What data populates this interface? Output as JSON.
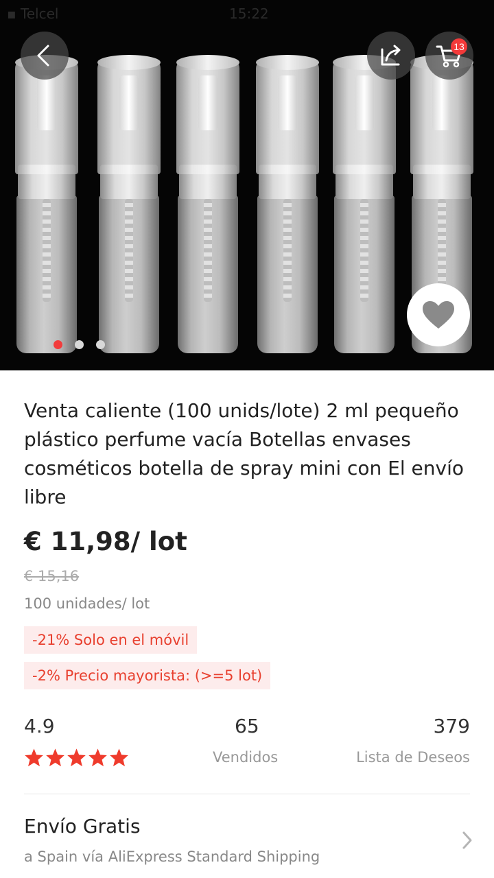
{
  "status_bar": {
    "left": "▪ Telcel ",
    "time": "15:22",
    "right": ""
  },
  "cart": {
    "badge_count": "13"
  },
  "carousel": {
    "total": 3,
    "active_index": 0
  },
  "product": {
    "title": "Venta caliente (100 unids/lote) 2 ml pequeño plástico perfume vacía Botellas envases cosméticos botella de spray mini con El envío libre",
    "price": "€ 11,98/ lot",
    "old_price": "€ 15,16",
    "unit_info": "100 unidades/ lot",
    "promos": [
      "-21% Solo en el móvil",
      "-2% Precio mayorista: (>=5 lot)"
    ]
  },
  "stats": {
    "rating": "4.9",
    "rating_stars": 5,
    "sold_value": "65",
    "sold_label": "Vendidos",
    "wishlist_value": "379",
    "wishlist_label": "Lista de Deseos"
  },
  "shipping": {
    "title": "Envío Gratis",
    "subtitle": "a Spain vía AliExpress Standard Shipping"
  },
  "colors": {
    "accent_red": "#f23c3c",
    "promo_text": "#e8402f",
    "promo_bg": "#fdecec",
    "star": "#ef3b2c"
  },
  "icons": [
    "back-arrow-icon",
    "share-icon",
    "cart-icon",
    "heart-icon",
    "star-icon",
    "chevron-right-icon"
  ]
}
